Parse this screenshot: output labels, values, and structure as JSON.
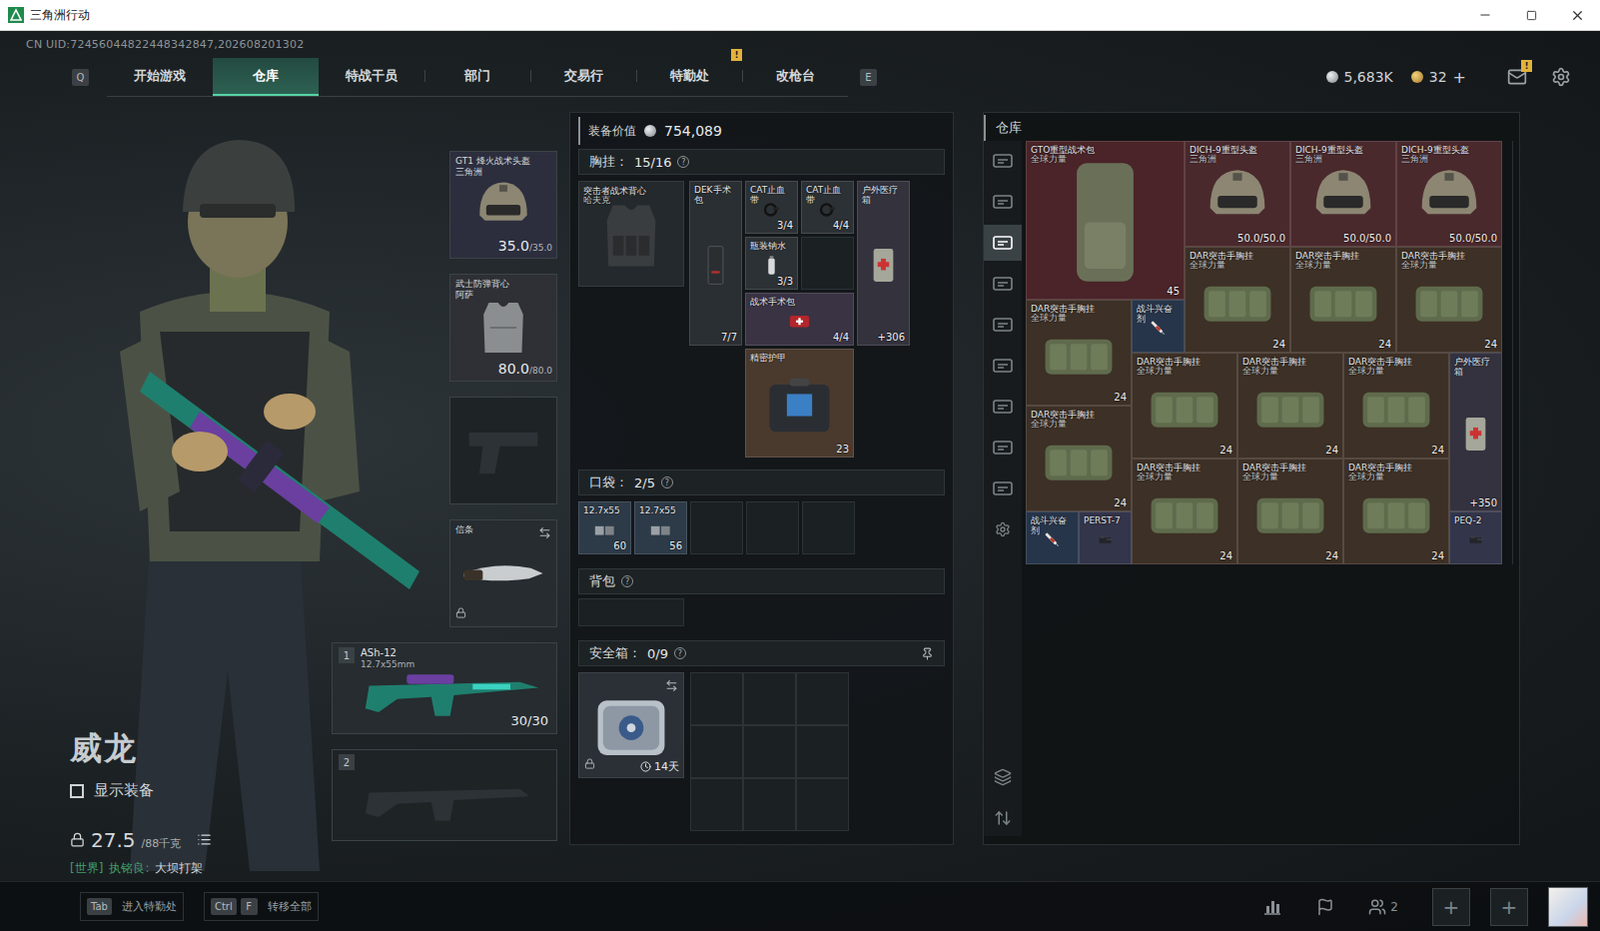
{
  "window": {
    "title": "三角洲行动"
  },
  "uid": "CN UID:72456044822448342847,202608201302",
  "nav": {
    "prev_key": "Q",
    "next_key": "E",
    "tabs": [
      {
        "label": "开始游戏",
        "selected": false
      },
      {
        "label": "仓库",
        "selected": true
      },
      {
        "label": "特战干员",
        "selected": false
      },
      {
        "label": "部门",
        "selected": false
      },
      {
        "label": "交易行",
        "selected": false
      },
      {
        "label": "特勤处",
        "selected": false,
        "badge": "!"
      },
      {
        "label": "改枪台",
        "selected": false
      }
    ]
  },
  "wallet": {
    "coins": "5,683K",
    "tickets": "32",
    "add": "+"
  },
  "mail": {
    "badge": "!"
  },
  "character": {
    "name": "威龙",
    "show_gear": {
      "label": "显示装备",
      "checked": false
    },
    "weight": {
      "current": "27.5",
      "max": "/88千克"
    },
    "chat": {
      "channel": "[世界]",
      "sender": "执铭良:",
      "message": "大坝打架"
    }
  },
  "gear": {
    "helmet": {
      "name": "GT1 烽火战术头盔",
      "maker": "三角洲",
      "durability": "35.0",
      "max": "/35.0",
      "color": "#2c2e3e"
    },
    "armor": {
      "name": "武士防弹背心",
      "maker": "阿萨",
      "durability": "80.0",
      "max": "/80.0",
      "color": "#2e3036"
    },
    "pistol": {
      "empty": true
    },
    "melee": {
      "name": "信条",
      "locked": true
    },
    "weapons": [
      {
        "number": "1",
        "name": "ASh-12",
        "caliber": "12.7x55mm",
        "ammo": "30/30",
        "empty": false
      },
      {
        "number": "2",
        "empty": true
      }
    ]
  },
  "loadout": {
    "value_label": "装备价值",
    "value": "754,089",
    "chest": {
      "label": "胸挂：",
      "count": "15/16",
      "help": "?",
      "rig": {
        "name": "突击者战术背心",
        "maker": "哈夫克"
      },
      "items": [
        {
          "name": "DEK手术包",
          "count": "7/7",
          "kind": "surgery",
          "color": "#2a2f33"
        },
        {
          "name": "CAT止血带",
          "count": "3/4",
          "kind": "tourniquet",
          "color": "#2c3135"
        },
        {
          "name": "CAT止血带",
          "count": "4/4",
          "kind": "tourniquet",
          "color": "#2c3135"
        },
        {
          "name": "户外医疗箱",
          "count": "+306",
          "kind": "medbox",
          "color": "#33323d"
        },
        {
          "name": "瓶装钠水",
          "count": "3/3",
          "kind": "bottle",
          "color": "#2c3135"
        },
        {
          "name": "战术手术包",
          "count": "4/4",
          "kind": "medkit",
          "color": "#3a3344"
        },
        {
          "name": "精密护甲",
          "count": "23",
          "kind": "repair",
          "color": "#4a3a2e"
        }
      ]
    },
    "pockets": {
      "label": "口袋：",
      "count": "2/5",
      "help": "?",
      "slots": [
        {
          "empty": false,
          "name": "12.7x55",
          "count": "60",
          "color": "#2d3a48"
        },
        {
          "empty": false,
          "name": "12.7x55",
          "count": "56",
          "color": "#2d3a48"
        },
        {
          "empty": true
        },
        {
          "empty": true
        },
        {
          "empty": true
        }
      ]
    },
    "backpack": {
      "label": "背包",
      "help": "?"
    },
    "safe": {
      "label": "安全箱：",
      "count": "0/9",
      "help": "?",
      "timer": "14天",
      "locked": true
    }
  },
  "warehouse": {
    "title": "仓库",
    "tabs": [
      {
        "selected": false
      },
      {
        "selected": false
      },
      {
        "selected": true
      },
      {
        "selected": false
      },
      {
        "selected": false
      },
      {
        "selected": false
      },
      {
        "selected": false
      },
      {
        "selected": false
      },
      {
        "selected": false
      }
    ],
    "items": [
      {
        "name": "GTO重型战术包",
        "maker": "全球力量",
        "count": "45",
        "kind": "bag",
        "color": "#4a2428"
      },
      {
        "name": "DICH-9重型头盔",
        "maker": "三角洲",
        "count": "50.0/50.0",
        "kind": "helmet",
        "color": "#4a292d"
      },
      {
        "name": "DICH-9重型头盔",
        "maker": "三角洲",
        "count": "50.0/50.0",
        "kind": "helmet",
        "color": "#4a292d"
      },
      {
        "name": "DICH-9重型头盔",
        "maker": "三角洲",
        "count": "50.0/50.0",
        "kind": "helmet",
        "color": "#4a292d"
      },
      {
        "name": "DAR突击手胸挂",
        "maker": "全球力量",
        "count": "24",
        "kind": "rig",
        "color": "#3d3026"
      },
      {
        "name": "DAR突击手胸挂",
        "maker": "全球力量",
        "count": "24",
        "kind": "rig",
        "color": "#3d3026"
      },
      {
        "name": "DAR突击手胸挂",
        "maker": "全球力量",
        "count": "24",
        "kind": "rig",
        "color": "#3d3026"
      },
      {
        "name": "DAR突击手胸挂",
        "maker": "全球力量",
        "count": "24",
        "kind": "rig",
        "color": "#3d3026"
      },
      {
        "name": "战斗兴奋剂",
        "kind": "stim",
        "color": "#27354a"
      },
      {
        "name": "DAR突击手胸挂",
        "maker": "全球力量",
        "count": "24",
        "kind": "rig",
        "color": "#3d3026"
      },
      {
        "name": "DAR突击手胸挂",
        "maker": "全球力量",
        "count": "24",
        "kind": "rig",
        "color": "#3d3026"
      },
      {
        "name": "DAR突击手胸挂",
        "maker": "全球力量",
        "count": "24",
        "kind": "rig",
        "color": "#3d3026"
      },
      {
        "name": "户外医疗箱",
        "count": "+350",
        "kind": "medbox",
        "color": "#34323f"
      },
      {
        "name": "DAR突击手胸挂",
        "maker": "全球力量",
        "count": "24",
        "kind": "rig",
        "color": "#3d3026"
      },
      {
        "name": "DAR突击手胸挂",
        "maker": "全球力量",
        "count": "24",
        "kind": "rig",
        "color": "#3d3026"
      },
      {
        "name": "DAR突击手胸挂",
        "maker": "全球力量",
        "count": "24",
        "kind": "rig",
        "color": "#3d3026"
      },
      {
        "name": "DAR突击手胸挂",
        "maker": "全球力量",
        "count": "24",
        "kind": "rig",
        "color": "#3d3026"
      },
      {
        "name": "战斗兴奋剂",
        "kind": "stim",
        "color": "#27354a"
      },
      {
        "name": "PERST-7",
        "kind": "attachment",
        "color": "#33354a"
      },
      {
        "name": "PEQ-2",
        "kind": "attachment",
        "color": "#33354a"
      }
    ]
  },
  "bottom_bar": {
    "hints": [
      {
        "keys": [
          "Tab"
        ],
        "label": "进入特勤处"
      },
      {
        "keys": [
          "Ctrl",
          "F"
        ],
        "label": "转移全部"
      }
    ],
    "friends": "2",
    "party_slots": [
      "+",
      "+"
    ]
  }
}
